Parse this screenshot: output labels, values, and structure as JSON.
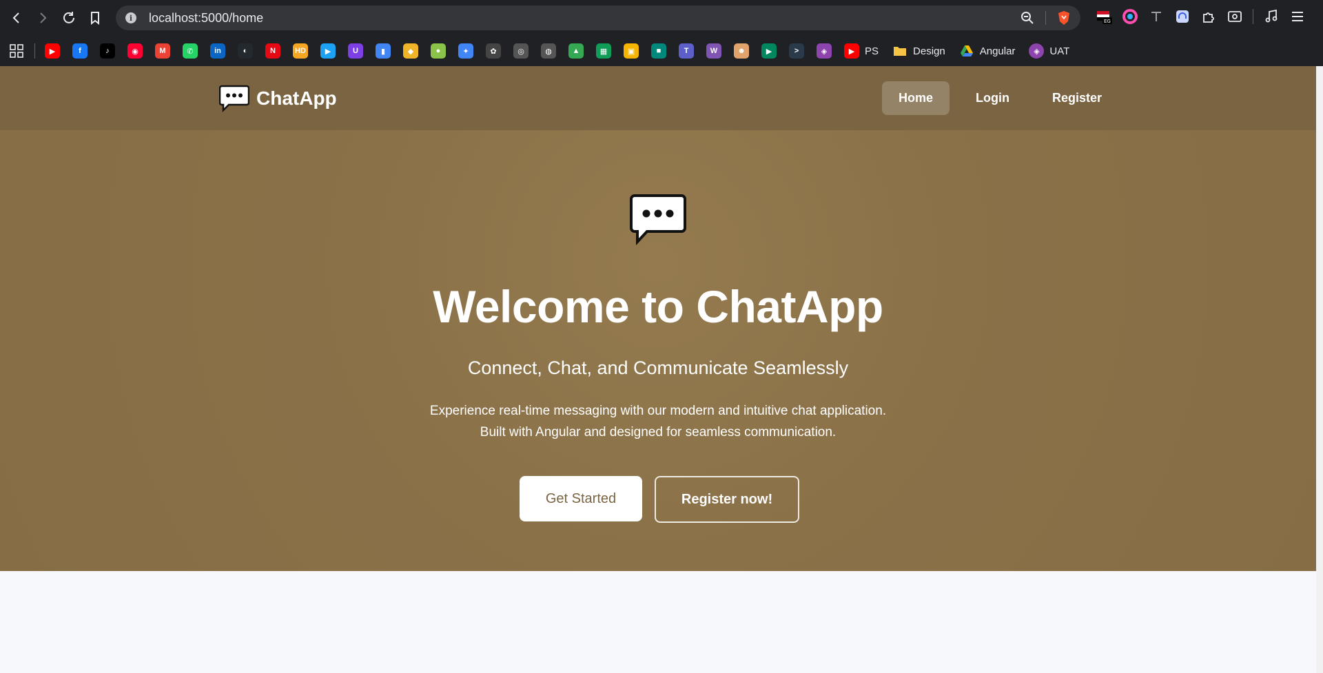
{
  "browser": {
    "url": "localhost:5000/home",
    "bookmarks": [
      {
        "name": "youtube",
        "color": "#ff0000",
        "glyph": "▶"
      },
      {
        "name": "facebook",
        "color": "#1877f2",
        "glyph": "f"
      },
      {
        "name": "tiktok",
        "color": "#000000",
        "glyph": "♪"
      },
      {
        "name": "youtube-music",
        "color": "#ff0033",
        "glyph": "◉"
      },
      {
        "name": "gmail",
        "color": "#ea4335",
        "glyph": "M"
      },
      {
        "name": "whatsapp",
        "color": "#25d366",
        "glyph": "✆"
      },
      {
        "name": "linkedin",
        "color": "#0a66c2",
        "glyph": "in"
      },
      {
        "name": "github",
        "color": "#24292f",
        "glyph": "◐"
      },
      {
        "name": "netflix",
        "color": "#e50914",
        "glyph": "N"
      },
      {
        "name": "hd",
        "color": "#f5a623",
        "glyph": "HD"
      },
      {
        "name": "play",
        "color": "#1da1f2",
        "glyph": "▶"
      },
      {
        "name": "u-app",
        "color": "#7b3fe4",
        "glyph": "U"
      },
      {
        "name": "charts",
        "color": "#4285f4",
        "glyph": "▮"
      },
      {
        "name": "flutter",
        "color": "#f0b429",
        "glyph": "◆"
      },
      {
        "name": "globe",
        "color": "#8bc34a",
        "glyph": "●"
      },
      {
        "name": "gemini",
        "color": "#4285f4",
        "glyph": "✦"
      },
      {
        "name": "openai",
        "color": "#444444",
        "glyph": "✿"
      },
      {
        "name": "copilot",
        "color": "#555555",
        "glyph": "◎"
      },
      {
        "name": "brain",
        "color": "#555555",
        "glyph": "◍"
      },
      {
        "name": "google-drive",
        "color": "#34a853",
        "glyph": "▲"
      },
      {
        "name": "google-sheets",
        "color": "#0f9d58",
        "glyph": "▦"
      },
      {
        "name": "google-classroom",
        "color": "#f4b400",
        "glyph": "▣"
      },
      {
        "name": "google-meet",
        "color": "#00897b",
        "glyph": "■"
      },
      {
        "name": "teams",
        "color": "#5b5fc7",
        "glyph": "T"
      },
      {
        "name": "woo",
        "color": "#7f54b3",
        "glyph": "W"
      },
      {
        "name": "avatar-app",
        "color": "#e0a36b",
        "glyph": "☻"
      },
      {
        "name": "play-store",
        "color": "#01875f",
        "glyph": "▶"
      },
      {
        "name": "terminal",
        "color": "#2b3a4a",
        "glyph": ">"
      },
      {
        "name": "purple-app",
        "color": "#8e44ad",
        "glyph": "◈"
      }
    ],
    "bookmark_labels": {
      "ps": "PS",
      "design": "Design",
      "angular": "Angular",
      "uat": "UAT"
    }
  },
  "app": {
    "brand": "ChatApp",
    "nav": [
      {
        "label": "Home",
        "active": true
      },
      {
        "label": "Login",
        "active": false
      },
      {
        "label": "Register",
        "active": false
      }
    ],
    "hero": {
      "title": "Welcome to ChatApp",
      "subtitle": "Connect, Chat, and Communicate Seamlessly",
      "description": "Experience real-time messaging with our modern and intuitive chat application. Built with Angular and designed for seamless communication.",
      "primary_button": "Get Started",
      "secondary_button": "Register now!"
    }
  },
  "colors": {
    "nav_bg": "#7a6442",
    "hero_bg": "#8b7148",
    "below_bg": "#f6f8fb"
  }
}
